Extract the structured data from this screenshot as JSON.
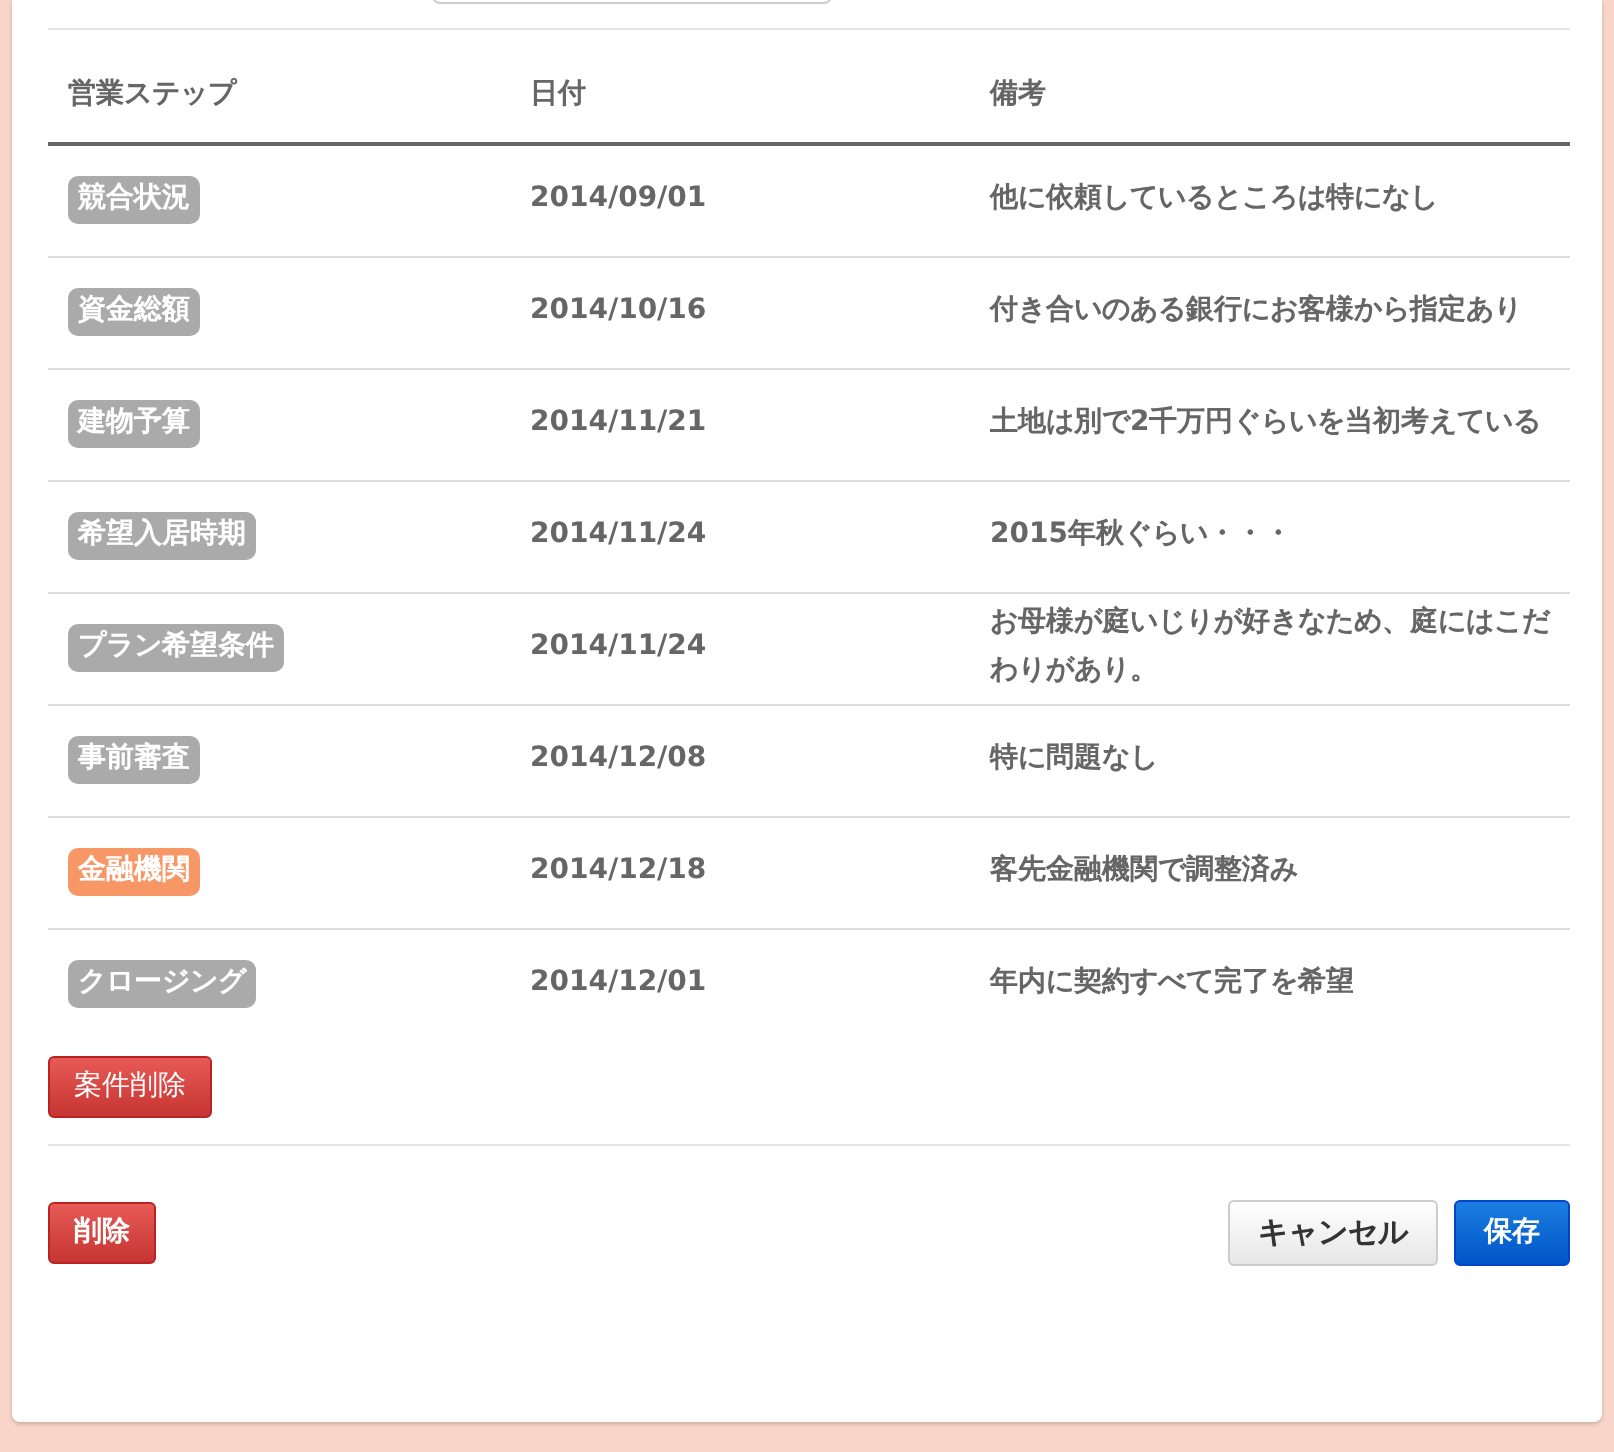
{
  "table": {
    "columns": [
      "営業ステップ",
      "日付",
      "備考"
    ],
    "rows": [
      {
        "step": "競合状況",
        "color": "#aaaaaa",
        "date": "2014/09/01",
        "note": "他に依頼しているところは特になし"
      },
      {
        "step": "資金総額",
        "color": "#aaaaaa",
        "date": "2014/10/16",
        "note": "付き合いのある銀行にお客様から指定あり"
      },
      {
        "step": "建物予算",
        "color": "#aaaaaa",
        "date": "2014/11/21",
        "note": "土地は別で2千万円ぐらいを当初考えている"
      },
      {
        "step": "希望入居時期",
        "color": "#aaaaaa",
        "date": "2014/11/24",
        "note": "2015年秋ぐらい・・・"
      },
      {
        "step": "プラン希望条件",
        "color": "#aaaaaa",
        "date": "2014/11/24",
        "note": "お母様が庭いじりが好きなため、庭にはこだわりがあり。"
      },
      {
        "step": "事前審査",
        "color": "#aaaaaa",
        "date": "2014/12/08",
        "note": "特に問題なし"
      },
      {
        "step": "金融機関",
        "color": "#f79765",
        "date": "2014/12/18",
        "note": "客先金融機関で調整済み"
      },
      {
        "step": "クロージング",
        "color": "#aaaaaa",
        "date": "2014/12/01",
        "note": "年内に契約すべて完了を希望"
      }
    ]
  },
  "delete_case_button": "案件削除",
  "footer": {
    "delete_button": "削除",
    "cancel_button": "キャンセル",
    "save_button": "保存"
  }
}
